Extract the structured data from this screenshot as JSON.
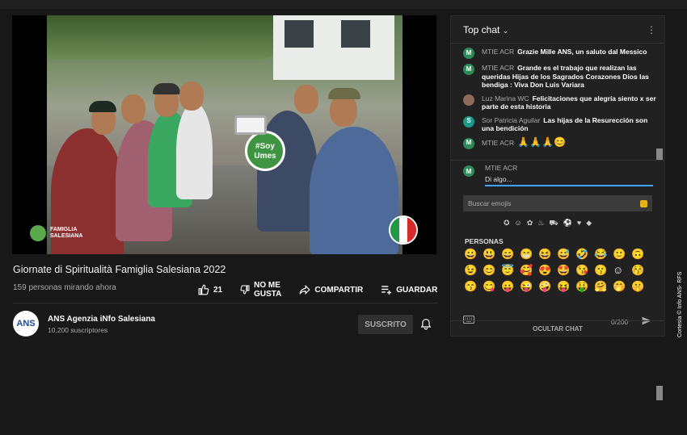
{
  "video": {
    "sign_text": "#Soy Umes",
    "watermark_line1": "FAMIGLIA",
    "watermark_line2": "SALESIANA"
  },
  "meta": {
    "title": "Giornate di Spiritualità Famiglia Salesiana 2022",
    "views": "159 personas mirando ahora",
    "likes": "21",
    "dislike_label_1": "NO ME",
    "dislike_label_2": "GUSTA",
    "share_label": "COMPARTIR",
    "save_label": "GUARDAR"
  },
  "channel": {
    "avatar_text": "ANS",
    "name": "ANS Agenzia iNfo Salesiana",
    "subs": "10,200 suscriptores",
    "subscribe_label": "SUSCRITO"
  },
  "chat": {
    "header": "Top chat",
    "messages": [
      {
        "initial": "M",
        "author": "MTIE ACR",
        "text": "Grazie Mille ANS, un saluto dal Messico"
      },
      {
        "initial": "M",
        "author": "MTIE ACR",
        "text": "Grande es el trabajo que realizan las queridas Hijas de los Sagrados Corazones Dios las bendiga : Viva Don Luis Variara"
      },
      {
        "initial": "",
        "author": "Luz Marina WC",
        "text": "Felicitaciones que alegría siento x ser parte de esta historia"
      },
      {
        "initial": "S",
        "author": "Sor Patricia Aguilar",
        "text": "Las hijas de la Resurección son una bendición"
      },
      {
        "initial": "M",
        "author": "MTIE ACR",
        "text": "🙏🙏🙏😊"
      }
    ],
    "composer": {
      "initial": "M",
      "author": "MTIE ACR",
      "placeholder": "Di algo...",
      "emoji_search_placeholder": "Buscar emojis",
      "category_icons": [
        "✪",
        "☺",
        "✿",
        "♨",
        "⛟",
        "⚽",
        "♥",
        "◆"
      ],
      "category_label": "PERSONAS",
      "emojis": [
        "😀",
        "😃",
        "😄",
        "😁",
        "😆",
        "😅",
        "🤣",
        "😂",
        "🙂",
        "🙃",
        "😉",
        "😊",
        "😇",
        "🥰",
        "😍",
        "🤩",
        "😘",
        "😗",
        "☺",
        "😚",
        "😙",
        "😋",
        "😛",
        "😜",
        "🤪",
        "😝",
        "🤑",
        "🤗",
        "🤭",
        "🤫"
      ],
      "counter": "0/200"
    },
    "hide_label": "OCULTAR CHAT"
  },
  "credit": "Cortesía © Info ANS- RFS"
}
